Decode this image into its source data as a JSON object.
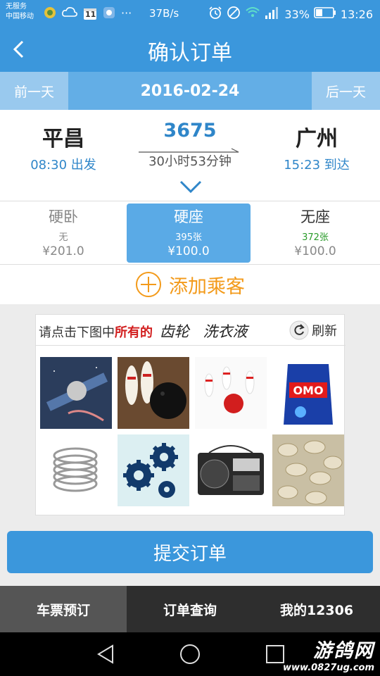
{
  "status_bar": {
    "carrier_line1": "无服务",
    "carrier_line2": "中国移动",
    "calendar_day": "11",
    "speed": "37B/s",
    "battery": "33%",
    "time": "13:26"
  },
  "header": {
    "title": "确认订单"
  },
  "date_bar": {
    "prev_label": "前一天",
    "date": "2016-02-24",
    "next_label": "后一天"
  },
  "train": {
    "number": "3675",
    "duration": "30小时53分钟",
    "from": {
      "name": "平昌",
      "time": "08:30 出发"
    },
    "to": {
      "name": "广州",
      "time": "15:23 到达"
    }
  },
  "seats": [
    {
      "name": "硬卧",
      "count": "无",
      "price": "¥201.0"
    },
    {
      "name": "硬座",
      "count": "395张",
      "price": "¥100.0"
    },
    {
      "name": "无座",
      "count": "372张",
      "price": "¥100.0"
    }
  ],
  "add_passenger": {
    "label": "添加乘客"
  },
  "captcha": {
    "prompt_prefix": "请点击下图中",
    "prompt_emphasis": "所有的",
    "word1": "齿轮",
    "word2": "洗衣液",
    "refresh_label": "刷新",
    "images": [
      "satellite",
      "bowling-pins-and-ball",
      "bowling-pins-strike",
      "detergent-bag",
      "metal-coil",
      "gears",
      "radio",
      "peanuts"
    ]
  },
  "submit": {
    "label": "提交订单"
  },
  "tabs": [
    {
      "label": "车票预订",
      "active": true
    },
    {
      "label": "订单查询",
      "active": false
    },
    {
      "label": "我的12306",
      "active": false
    }
  ],
  "watermark": {
    "big": "游鸽网",
    "small": "www.0827ug.com"
  },
  "colors": {
    "primary": "#3b97dc",
    "accent": "#f39a1a",
    "seat_selected": "#5aaae6",
    "count_green": "#2a9b2a"
  }
}
